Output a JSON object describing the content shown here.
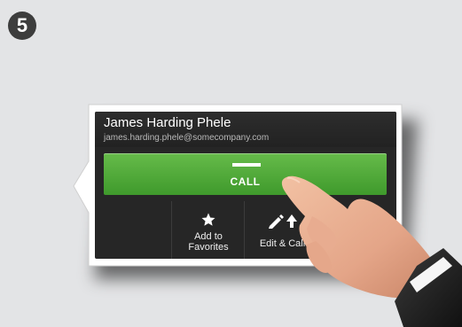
{
  "step": {
    "number": "5"
  },
  "contact": {
    "name": "James Harding Phele",
    "email": "james.harding.phele@somecompany.com"
  },
  "call_button": {
    "label": "CALL",
    "color": "#4caf3a"
  },
  "actions": [
    {
      "icon": "star-icon",
      "label_line1": "Add to",
      "label_line2": "Favorites"
    },
    {
      "icon": "edit-call-icon",
      "label_line1": "Edit & Call"
    }
  ],
  "colors": {
    "background": "#e3e4e6",
    "panel": "#262626",
    "call_green": "#4caf3a",
    "text_secondary": "#b9b9b9"
  }
}
